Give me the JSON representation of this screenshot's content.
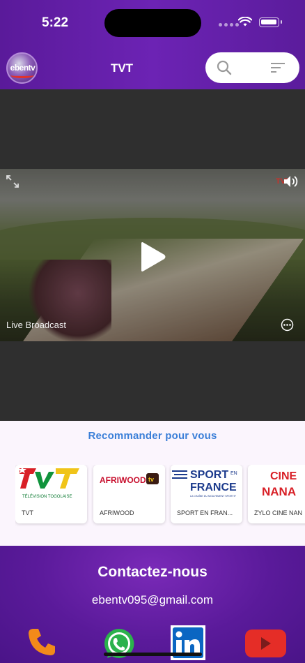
{
  "status_bar": {
    "time": "5:22"
  },
  "app_bar": {
    "logo_text": "ebentv",
    "title": "TVT",
    "search_icon": "search-icon",
    "filter_icon": "filter-icon"
  },
  "player": {
    "live_label": "Live Broadcast",
    "channel_mark": "TVT",
    "icons": [
      "expand-icon",
      "play-icon",
      "volume-icon",
      "more-icon"
    ]
  },
  "recommend": {
    "title": "Recommander pour vous",
    "items": [
      {
        "label": "TVT",
        "logo_text": "TVT",
        "logo_sub": "TÉLÉVISION TOGOLAISE"
      },
      {
        "label": "AFRIWOOD",
        "logo_text": "AFRIWOOD",
        "logo_sub": "tv"
      },
      {
        "label": "SPORT EN FRAN...",
        "logo_text": "SPORT",
        "logo_text2": "FRANCE",
        "logo_en": "EN",
        "logo_sub": "LA CHAÎNE DU MOUVEMENT SPORTIF"
      },
      {
        "label": "ZYLO CINE NAN",
        "logo_text": "CINE",
        "logo_text2": "NANA"
      }
    ]
  },
  "contact": {
    "title": "Contactez-nous",
    "email": "ebentv095@gmail.com",
    "icons": [
      "phone-icon",
      "whatsapp-icon",
      "linkedin-icon",
      "youtube-icon"
    ]
  },
  "colors": {
    "header": "#6c23b4",
    "accent_blue": "#3b7fd8",
    "phone": "#f28a1a",
    "whatsapp": "#2bb24c",
    "linkedin": "#0a66c2",
    "youtube": "#e52d27"
  }
}
